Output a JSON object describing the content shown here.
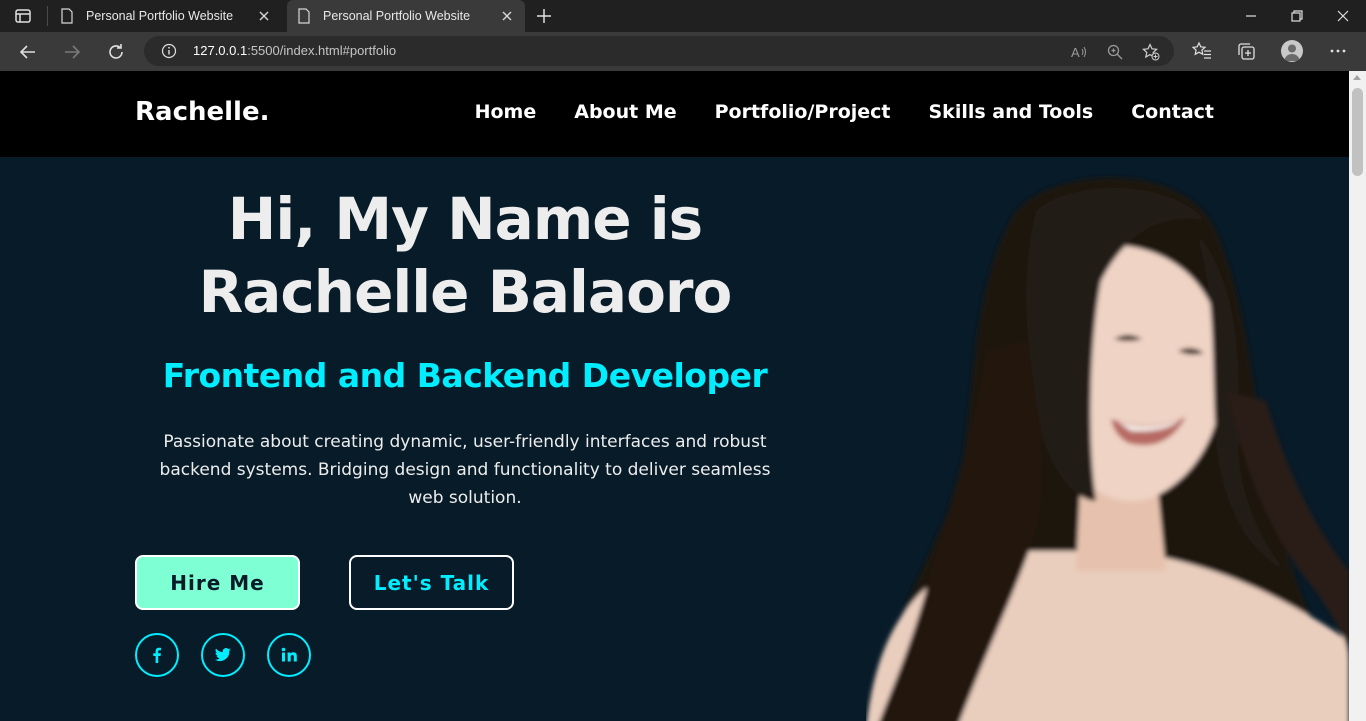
{
  "browser": {
    "tabs": [
      {
        "title": "Personal Portfolio Website"
      },
      {
        "title": "Personal Portfolio Website"
      }
    ],
    "url_host": "127.0.0.1",
    "url_rest": ":5500/index.html#portfolio"
  },
  "site": {
    "logo": "Rachelle.",
    "nav": [
      "Home",
      "About Me",
      "Portfolio/Project",
      "Skills and Tools",
      "Contact"
    ],
    "hero": {
      "title_line1": "Hi, My Name is",
      "title_line2": "Rachelle Balaoro",
      "subtitle": "Frontend and Backend Developer",
      "description": "Passionate about creating dynamic, user-friendly interfaces and robust backend systems. Bridging design and functionality to deliver seamless web solution.",
      "btn_hire": "Hire Me",
      "btn_talk": "Let's Talk"
    },
    "social": [
      "facebook-icon",
      "twitter-icon",
      "linkedin-icon"
    ]
  },
  "colors": {
    "page_bg": "#081b29",
    "header_bg": "#000000",
    "accent": "#00eeff",
    "hire_bg": "#7fffd4",
    "text": "#ededed"
  }
}
